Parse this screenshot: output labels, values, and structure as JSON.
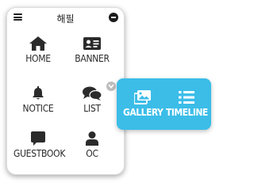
{
  "panel": {
    "title": "해필",
    "menu_icon": "hamburger-icon",
    "close_icon": "minus-circle-icon"
  },
  "menu": {
    "items": [
      {
        "label": "HOME",
        "icon": "home-icon"
      },
      {
        "label": "BANNER",
        "icon": "id-card-icon"
      },
      {
        "label": "NOTICE",
        "icon": "bell-icon"
      },
      {
        "label": "LIST",
        "icon": "chat-bubbles-icon"
      },
      {
        "label": "GUESTBOOK",
        "icon": "speech-bubble-icon"
      },
      {
        "label": "OC",
        "icon": "user-icon"
      }
    ]
  },
  "submenu": {
    "items": [
      {
        "label": "GALLERY",
        "icon": "images-icon"
      },
      {
        "label": "TIMELINE",
        "icon": "list-icon"
      }
    ]
  },
  "colors": {
    "submenu_bg": "#3bbde8",
    "icon": "#2b2b2b",
    "expand_dot": "#bdbdbd"
  }
}
